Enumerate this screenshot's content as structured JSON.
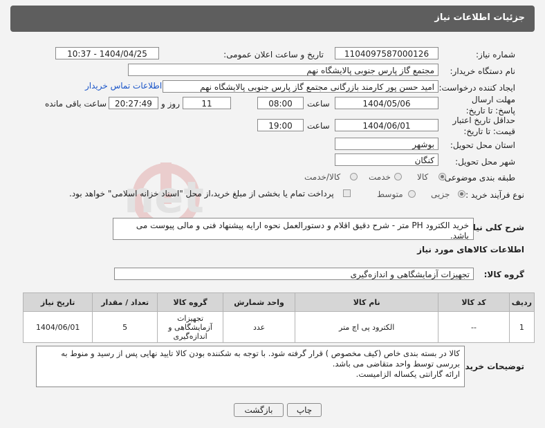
{
  "header": {
    "title": "جزئیات اطلاعات نیاز"
  },
  "form": {
    "need_number": {
      "label": "شماره نیاز:",
      "value": "1104097587000126"
    },
    "announce": {
      "label": "تاریخ و ساعت اعلان عمومی:",
      "value": "1404/04/25 - 10:37"
    },
    "buyer": {
      "label": "نام دستگاه خریدار:",
      "value": "مجتمع گاز پارس جنوبی  پالایشگاه نهم"
    },
    "creator": {
      "label": "ایجاد کننده درخواست:",
      "value": "امید حسن پور کارمند بازرگانی مجتمع گاز پارس جنوبی  پالایشگاه نهم",
      "contact_link": "اطلاعات تماس خریدار"
    },
    "reply_deadline": {
      "label": "مهلت ارسال پاسخ: تا تاریخ:",
      "date": "1404/05/06",
      "time_label": "ساعت",
      "time": "08:00",
      "days": "11",
      "days_label": "روز و",
      "remaining": "20:27:49",
      "remaining_label": "ساعت باقی مانده"
    },
    "price_validity": {
      "label": "حداقل تاریخ اعتبار قیمت: تا تاریخ:",
      "date": "1404/06/01",
      "time_label": "ساعت",
      "time": "19:00"
    },
    "province": {
      "label": "استان محل تحویل:",
      "value": "بوشهر"
    },
    "city": {
      "label": "شهر محل تحویل:",
      "value": "کنگان"
    },
    "category": {
      "label": "طبقه بندی موضوعی:",
      "options": [
        "کالا",
        "خدمت",
        "کالا/خدمت"
      ],
      "selected": "کالا"
    },
    "process": {
      "label": "نوع فرآیند خرید :",
      "options": [
        "جزیی",
        "متوسط"
      ],
      "selected": "جزیی",
      "payment_note": "پرداخت تمام یا بخشی از مبلغ خرید،از محل \"اسناد خزانه اسلامی\" خواهد بود."
    },
    "description": {
      "label": "شرح کلی نیاز:",
      "value": "خرید الکترود PH متر - شرح دقیق اقلام و دستورالعمل نحوه ارایه پیشنهاد فنی و مالی پیوست می باشد."
    }
  },
  "goods_section": {
    "title": "اطلاعات کالاهای مورد نیاز",
    "group_label": "گروه کالا:",
    "group_value": "تجهیزات آزمایشگاهی و اندازه‌گیری"
  },
  "table": {
    "headers": [
      "ردیف",
      "کد کالا",
      "نام کالا",
      "واحد شمارش",
      "گروه کالا",
      "تعداد / مقدار",
      "تاریخ نیاز"
    ],
    "rows": [
      [
        "1",
        "--",
        "الکترود پی اچ متر",
        "عدد",
        "تجهیزات آزمایشگاهی و اندازه‌گیری",
        "5",
        "1404/06/01"
      ]
    ]
  },
  "buyer_notes": {
    "label": "توضیحات خریدار:",
    "lines": [
      "کالا در بسته بندی خاص (کیف مخصوص ) قرار گرفته شود. با توجه به شکننده بودن کالا تایید نهایی پس از رسید و منوط به",
      "بررسی توسط واحد متقاضی می باشد.",
      "ارائه گارانتی یکساله الزامیست."
    ]
  },
  "buttons": {
    "print": "چاپ",
    "back": "بازگشت"
  },
  "watermark": {
    "text": "AriaTender.net"
  }
}
